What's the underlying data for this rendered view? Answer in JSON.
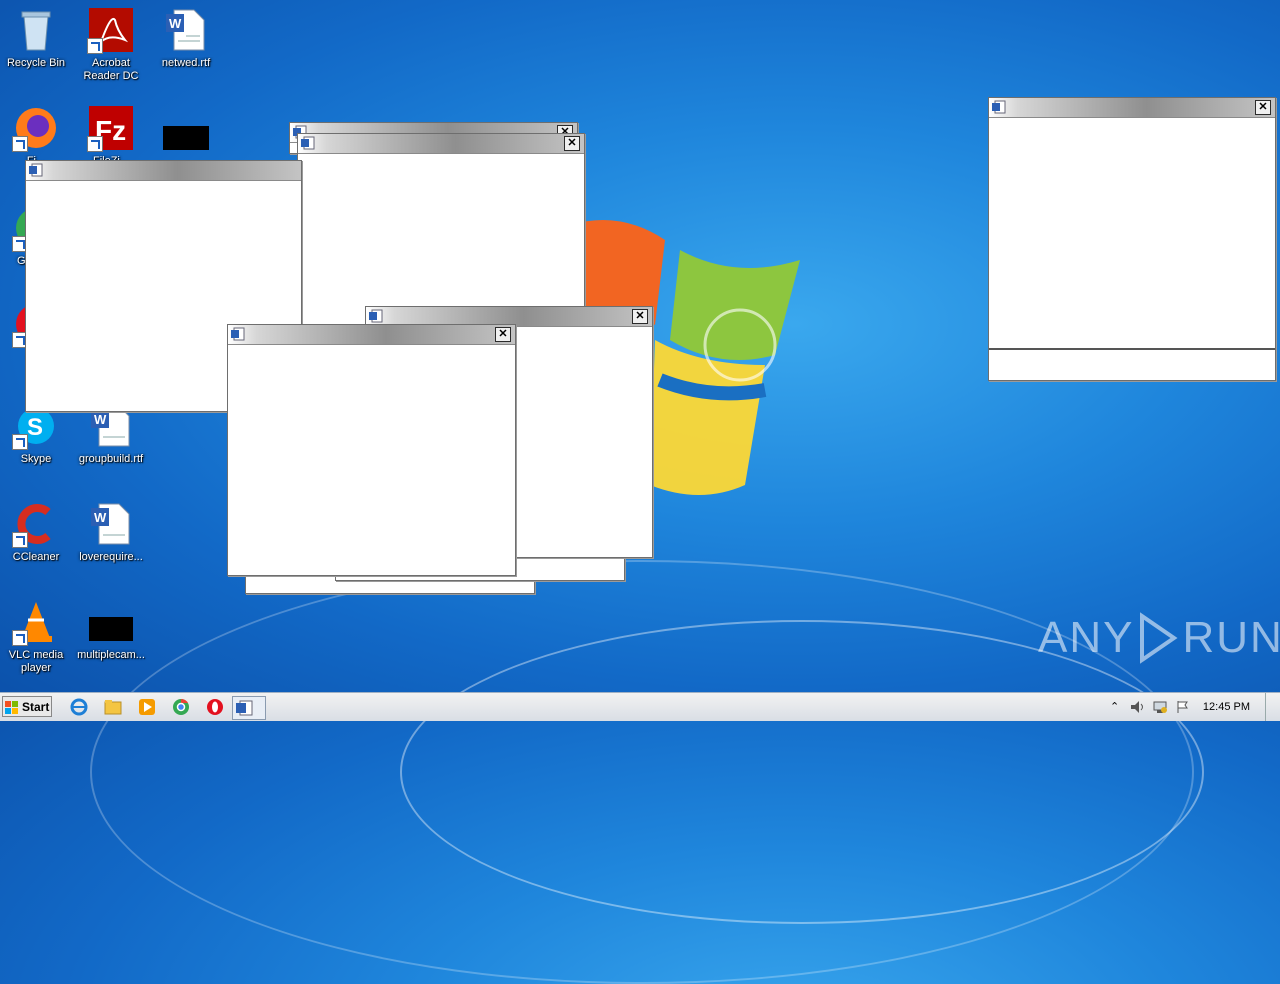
{
  "desktop": {
    "icons": [
      {
        "label": "Recycle Bin",
        "icon": "recycle-bin-icon"
      },
      {
        "label": "Acrobat Reader DC",
        "icon": "acrobat-icon"
      },
      {
        "label": "netwed.rtf",
        "icon": "word-doc-icon"
      },
      {
        "label": "Fi...",
        "icon": "firefox-icon"
      },
      {
        "label": "FileZi...",
        "icon": "filezilla-icon"
      },
      {
        "label": "",
        "icon": "redacted-icon"
      },
      {
        "label": "G... C...",
        "icon": "chrome-icon"
      },
      {
        "label": "O...",
        "icon": "opera-icon"
      },
      {
        "label": "Skype",
        "icon": "skype-icon"
      },
      {
        "label": "groupbuild.rtf",
        "icon": "word-doc-icon"
      },
      {
        "label": "CCleaner",
        "icon": "ccleaner-icon"
      },
      {
        "label": "loverequire...",
        "icon": "word-doc-icon"
      },
      {
        "label": "VLC media player",
        "icon": "vlc-icon"
      },
      {
        "label": "multiplecam...",
        "icon": "redacted-icon"
      }
    ]
  },
  "windows": [
    {
      "name": "dialog-1",
      "icon": "word-icon"
    },
    {
      "name": "dialog-2",
      "icon": "word-icon"
    },
    {
      "name": "dialog-3",
      "icon": "word-icon"
    },
    {
      "name": "dialog-4",
      "icon": "word-icon"
    },
    {
      "name": "dialog-5",
      "icon": "word-icon"
    },
    {
      "name": "dialog-6",
      "icon": "word-icon"
    }
  ],
  "watermark": {
    "text_left": "ANY",
    "text_right": "RUN"
  },
  "taskbar": {
    "start_label": "Start",
    "pinned": [
      "ie-icon",
      "explorer-icon",
      "media-player-icon",
      "chrome-icon",
      "opera-icon",
      "word-icon"
    ],
    "clock": "12:45 PM"
  },
  "colors": {
    "desktop": "#1f86dc",
    "taskbar": "#d9dee5"
  }
}
